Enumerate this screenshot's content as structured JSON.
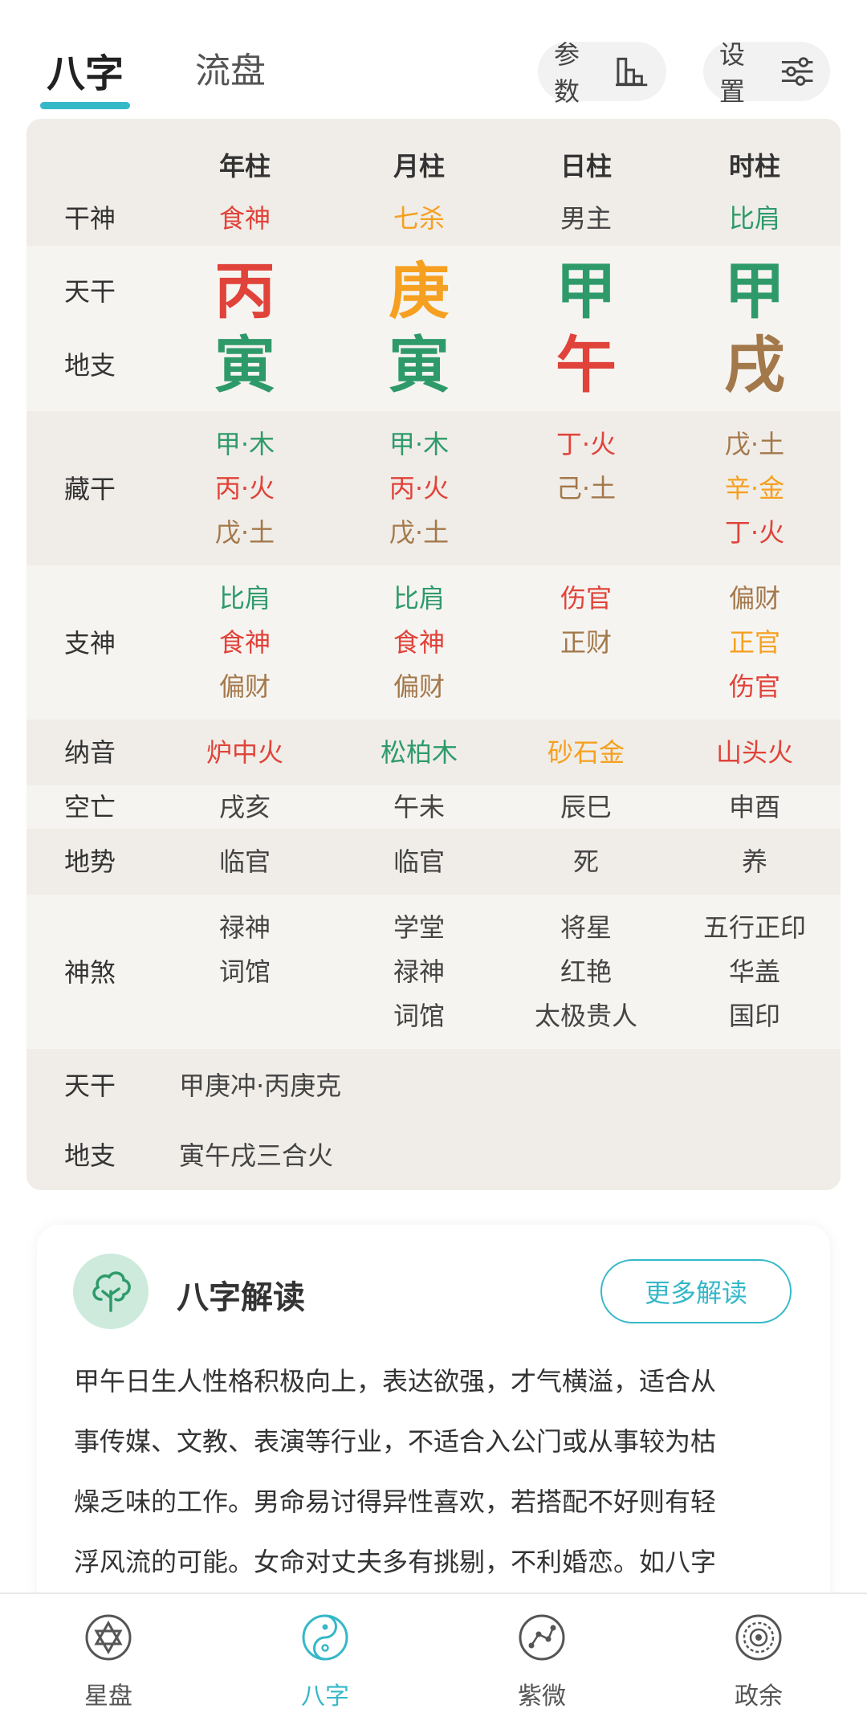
{
  "header": {
    "tabs": [
      {
        "label": "八字",
        "active": true
      },
      {
        "label": "流盘",
        "active": false
      }
    ],
    "params_label": "参数",
    "settings_label": "设置",
    "accent_color": "#35b8c8"
  },
  "chart": {
    "columns": [
      "年柱",
      "月柱",
      "日柱",
      "时柱"
    ],
    "rows": {
      "shishen": {
        "label": "干神",
        "values": [
          "食神",
          "七杀",
          "男主",
          "比肩"
        ]
      },
      "tiangan": {
        "label": "天干",
        "values": [
          "丙",
          "庚",
          "甲",
          "甲"
        ]
      },
      "dizhi": {
        "label": "地支",
        "values": [
          "寅",
          "寅",
          "午",
          "戌"
        ]
      },
      "canggan": {
        "label": "藏干",
        "values": [
          [
            "甲·木",
            "丙·火",
            "戊·土"
          ],
          [
            "甲·木",
            "丙·火",
            "戊·土"
          ],
          [
            "丁·火",
            "己·土"
          ],
          [
            "戊·土",
            "辛·金",
            "丁·火"
          ]
        ]
      },
      "zhishen": {
        "label": "支神",
        "values": [
          [
            "比肩",
            "食神",
            "偏财"
          ],
          [
            "比肩",
            "食神",
            "偏财"
          ],
          [
            "伤官",
            "正财"
          ],
          [
            "偏财",
            "正官",
            "伤官"
          ]
        ]
      },
      "nayin": {
        "label": "纳音",
        "values": [
          "炉中火",
          "松柏木",
          "砂石金",
          "山头火"
        ]
      },
      "kongwang": {
        "label": "空亡",
        "values": [
          "戌亥",
          "午未",
          "辰巳",
          "申酉"
        ]
      },
      "dishi": {
        "label": "地势",
        "values": [
          "临官",
          "临官",
          "死",
          "养"
        ]
      },
      "shensha": {
        "label": "神煞",
        "values": [
          [
            "禄神",
            "词馆"
          ],
          [
            "学堂",
            "禄神",
            "词馆"
          ],
          [
            "将星",
            "红艳",
            "太极贵人"
          ],
          [
            "五行正印",
            "华盖",
            "国印"
          ]
        ]
      }
    },
    "relations": [
      {
        "label": "天干",
        "value": "甲庚冲·丙庚克"
      },
      {
        "label": "地支",
        "value": "寅午戌三合火"
      }
    ]
  },
  "reading": {
    "title": "八字解读",
    "more_label": "更多解读",
    "lines": [
      "甲午日生人性格积极向上，表达欲强，才气横溢，适合从",
      "事传媒、文教、表演等行业，不适合入公门或从事较为枯",
      "燥乏味的工作。男命易讨得异性喜欢，若搭配不好则有轻",
      "浮风流的可能。女命对丈夫多有挑剔，不利婚恋。如八字"
    ]
  },
  "bottom_nav": [
    {
      "label": "星盘",
      "icon": "star-of-david-icon",
      "active": false
    },
    {
      "label": "八字",
      "icon": "yin-yang-icon",
      "active": true
    },
    {
      "label": "紫微",
      "icon": "constellation-icon",
      "active": false
    },
    {
      "label": "政余",
      "icon": "target-circle-icon",
      "active": false
    }
  ],
  "colors": {
    "red": "#e0433a",
    "orange": "#f5a020",
    "green": "#2e9a6a",
    "brown": "#a3784b"
  }
}
